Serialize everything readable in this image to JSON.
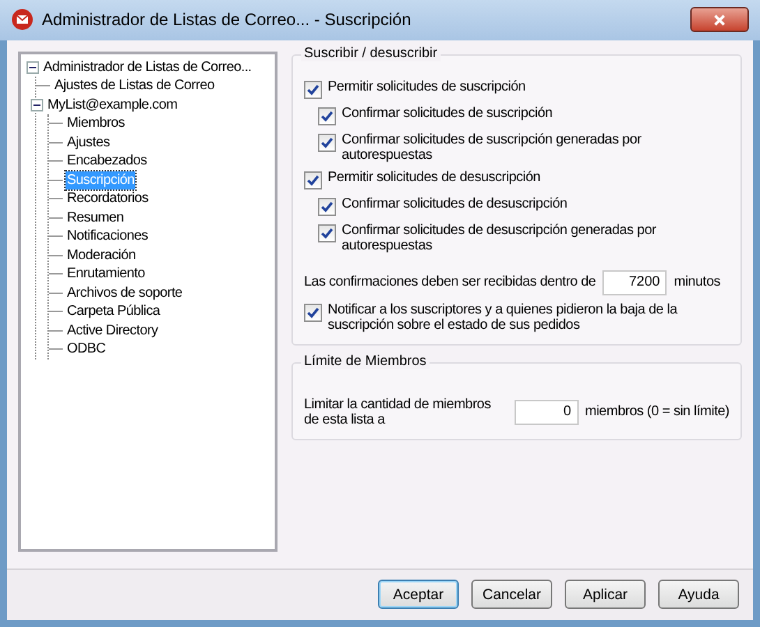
{
  "window": {
    "title": "Administrador de Listas de Correo... - Suscripción"
  },
  "tree": [
    {
      "label": "Administrador de Listas de Correo...",
      "selected": false,
      "expanded": true,
      "children": [
        {
          "label": "Ajustes de Listas de Correo",
          "selected": false
        },
        {
          "label": "MyList@example.com",
          "selected": false,
          "expanded": true,
          "children": [
            {
              "label": "Miembros",
              "selected": false
            },
            {
              "label": "Ajustes",
              "selected": false
            },
            {
              "label": "Encabezados",
              "selected": false
            },
            {
              "label": "Suscripción",
              "selected": true
            },
            {
              "label": "Recordatorios",
              "selected": false
            },
            {
              "label": "Resumen",
              "selected": false
            },
            {
              "label": "Notificaciones",
              "selected": false
            },
            {
              "label": "Moderación",
              "selected": false
            },
            {
              "label": "Enrutamiento",
              "selected": false
            },
            {
              "label": "Archivos de soporte",
              "selected": false
            },
            {
              "label": "Carpeta Pública",
              "selected": false
            },
            {
              "label": "Active Directory",
              "selected": false
            },
            {
              "label": "ODBC",
              "selected": false
            }
          ]
        }
      ]
    }
  ],
  "groups": [
    {
      "title": "Suscribir / desuscribir",
      "items": [
        {
          "kind": "checkbox",
          "label": "Permitir solicitudes de suscripción",
          "checked": true,
          "children": [
            {
              "kind": "checkbox",
              "label": "Confirmar solicitudes de suscripción",
              "checked": true
            },
            {
              "kind": "checkbox",
              "label": "Confirmar solicitudes de suscripción generadas por autorespuestas",
              "checked": true
            }
          ]
        },
        {
          "kind": "checkbox",
          "label": "Permitir solicitudes de desuscripción",
          "checked": true,
          "children": [
            {
              "kind": "checkbox",
              "label": "Confirmar solicitudes de desuscripción",
              "checked": true
            },
            {
              "kind": "checkbox",
              "label": "Confirmar solicitudes de desuscripción generadas por autorespuestas",
              "checked": true
            }
          ]
        },
        {
          "kind": "number",
          "label": "Las confirmaciones deben ser recibidas dentro de",
          "value": "7200",
          "unit": "minutos"
        },
        {
          "kind": "checkbox",
          "label": "Notificar a los suscriptores y a quienes pidieron la baja de la suscripción sobre el estado de sus pedidos",
          "checked": true
        }
      ]
    },
    {
      "title": "Límite de Miembros",
      "items": [
        {
          "kind": "number",
          "label": "Limitar la cantidad de miembros de esta lista a",
          "value": "0",
          "unit": "miembros (0 = sin límite)"
        }
      ]
    }
  ],
  "buttons": [
    {
      "label": "Aceptar",
      "default": true
    },
    {
      "label": "Cancelar",
      "default": false
    },
    {
      "label": "Aplicar",
      "default": false
    },
    {
      "label": "Ayuda",
      "default": false
    }
  ]
}
